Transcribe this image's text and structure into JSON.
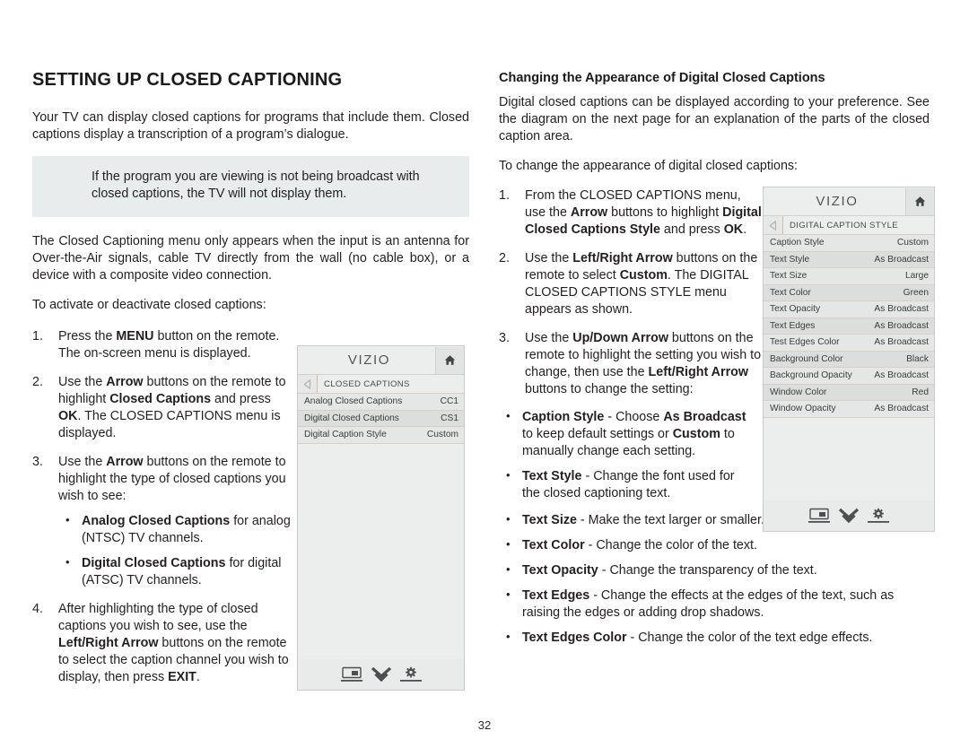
{
  "page": {
    "number": "32"
  },
  "left": {
    "title": "SETTING UP CLOSED CAPTIONING",
    "intro": "Your TV can display closed captions for programs that include them. Closed captions display a transcription of a program’s dialogue.",
    "callout": "If the program you are viewing is not being broadcast with closed captions, the TV will not display them.",
    "note": "The Closed Captioning menu only appears when the input is an antenna for Over-the-Air signals, cable TV directly from the wall (no cable box), or a device with a composite video connection.",
    "lead_in": "To activate or deactivate closed captions:",
    "steps": [
      {
        "num": "1.",
        "parts": [
          {
            "t": "Press the ",
            "b": false
          },
          {
            "t": "MENU",
            "b": true
          },
          {
            "t": " button on the remote. The on-screen menu is displayed.",
            "b": false
          }
        ]
      },
      {
        "num": "2.",
        "parts": [
          {
            "t": "Use the ",
            "b": false
          },
          {
            "t": "Arrow",
            "b": true
          },
          {
            "t": " buttons on the remote to highlight ",
            "b": false
          },
          {
            "t": "Closed Captions",
            "b": true
          },
          {
            "t": " and press ",
            "b": false
          },
          {
            "t": "OK",
            "b": true
          },
          {
            "t": ". The CLOSED CAPTIONS menu is displayed.",
            "b": false
          }
        ]
      },
      {
        "num": "3.",
        "parts": [
          {
            "t": "Use the ",
            "b": false
          },
          {
            "t": "Arrow",
            "b": true
          },
          {
            "t": " buttons on the remote to highlight the type of closed captions you wish to see:",
            "b": false
          }
        ],
        "bullets": [
          [
            {
              "t": "Analog Closed Captions",
              "b": true
            },
            {
              "t": " for analog (NTSC) TV channels.",
              "b": false
            }
          ],
          [
            {
              "t": "Digital Closed Captions",
              "b": true
            },
            {
              "t": " for digital (ATSC) TV channels.",
              "b": false
            }
          ]
        ]
      },
      {
        "num": "4.",
        "parts": [
          {
            "t": "After highlighting the type of closed captions you wish to see, use the ",
            "b": false
          },
          {
            "t": "Left/Right Arrow",
            "b": true
          },
          {
            "t": " buttons on the remote to select the caption channel you wish to display, then press ",
            "b": false
          },
          {
            "t": "EXIT",
            "b": true
          },
          {
            "t": ".",
            "b": false
          }
        ]
      }
    ]
  },
  "right": {
    "title": "Changing the Appearance of Digital Closed Captions",
    "intro": "Digital closed captions can be displayed according to your preference. See the diagram on the next page for an explanation of the parts of the closed caption area.",
    "lead_in": "To change the appearance of digital closed captions:",
    "steps": [
      {
        "num": "1.",
        "parts": [
          {
            "t": "From the CLOSED CAPTIONS menu, use the ",
            "b": false
          },
          {
            "t": "Arrow",
            "b": true
          },
          {
            "t": " buttons to highlight ",
            "b": false
          },
          {
            "t": "Digital Closed Captions Style",
            "b": true
          },
          {
            "t": " and press ",
            "b": false
          },
          {
            "t": "OK",
            "b": true
          },
          {
            "t": ".",
            "b": false
          }
        ]
      },
      {
        "num": "2.",
        "parts": [
          {
            "t": "Use the ",
            "b": false
          },
          {
            "t": "Left/Right Arrow",
            "b": true
          },
          {
            "t": " buttons on the remote to select ",
            "b": false
          },
          {
            "t": "Custom",
            "b": true
          },
          {
            "t": ". The DIGITAL CLOSED CAPTIONS STYLE menu appears as shown.",
            "b": false
          }
        ]
      },
      {
        "num": "3.",
        "parts": [
          {
            "t": "Use the ",
            "b": false
          },
          {
            "t": "Up/Down Arrow",
            "b": true
          },
          {
            "t": " buttons on the remote to highlight the setting you wish to change, then use the ",
            "b": false
          },
          {
            "t": "Left/Right Arrow",
            "b": true
          },
          {
            "t": " buttons to change the setting:",
            "b": false
          }
        ]
      }
    ],
    "bullets_narrow": [
      [
        {
          "t": "Caption Style",
          "b": true
        },
        {
          "t": " - Choose ",
          "b": false
        },
        {
          "t": "As Broadcast",
          "b": true
        },
        {
          "t": " to keep default settings or ",
          "b": false
        },
        {
          "t": "Custom",
          "b": true
        },
        {
          "t": " to manually change each setting.",
          "b": false
        }
      ],
      [
        {
          "t": "Text Style",
          "b": true
        },
        {
          "t": "  - Change the font used for the closed captioning text.",
          "b": false
        }
      ]
    ],
    "bullets_wide": [
      [
        {
          "t": "Text Size",
          "b": true
        },
        {
          "t": " - Make the text larger or smaller.",
          "b": false
        }
      ],
      [
        {
          "t": "Text Color",
          "b": true
        },
        {
          "t": " - Change the color of the text.",
          "b": false
        }
      ],
      [
        {
          "t": "Text Opacity",
          "b": true
        },
        {
          "t": " - Change the transparency of the text.",
          "b": false
        }
      ],
      [
        {
          "t": "Text Edges",
          "b": true
        },
        {
          "t": " - Change the effects at the edges of the text, such as raising the edges or adding drop shadows.",
          "b": false
        }
      ],
      [
        {
          "t": "Text Edges Color",
          "b": true
        },
        {
          "t": " - Change the color of the text edge effects.",
          "b": false
        }
      ]
    ]
  },
  "tv_menu_1": {
    "logo": "VIZIO",
    "breadcrumb": "CLOSED CAPTIONS",
    "rows": [
      {
        "label": "Analog Closed Captions",
        "value": "CC1"
      },
      {
        "label": "Digital Closed Captions",
        "value": "CS1"
      },
      {
        "label": "Digital Caption Style",
        "value": "Custom"
      }
    ],
    "footer_icons": [
      "picture-settings-icon",
      "chevron-double-down-icon",
      "gear-icon"
    ]
  },
  "tv_menu_2": {
    "logo": "VIZIO",
    "breadcrumb": "DIGITAL CAPTION STYLE",
    "rows": [
      {
        "label": "Caption Style",
        "value": "Custom"
      },
      {
        "label": "Text Style",
        "value": "As Broadcast"
      },
      {
        "label": "Text Size",
        "value": "Large"
      },
      {
        "label": "Text Color",
        "value": "Green"
      },
      {
        "label": "Text Opacity",
        "value": "As Broadcast"
      },
      {
        "label": "Text Edges",
        "value": "As Broadcast"
      },
      {
        "label": "Test Edges Color",
        "value": "As Broadcast"
      },
      {
        "label": "Background Color",
        "value": "Black"
      },
      {
        "label": "Background Opacity",
        "value": "As Broadcast"
      },
      {
        "label": "Window Color",
        "value": "Red"
      },
      {
        "label": "Window Opacity",
        "value": "As Broadcast"
      }
    ],
    "footer_icons": [
      "picture-settings-icon",
      "chevron-double-down-icon",
      "gear-icon"
    ]
  },
  "colors": {
    "page_bg": "#ffffff",
    "text": "#231f20",
    "callout_bg": "#e9ecec",
    "menu_bg": "#eceded",
    "menu_row_odd": "#e5e6e6",
    "menu_row_even": "#dcdddd",
    "menu_border": "#c9caca",
    "menu_accent": "#d4b9b4"
  }
}
